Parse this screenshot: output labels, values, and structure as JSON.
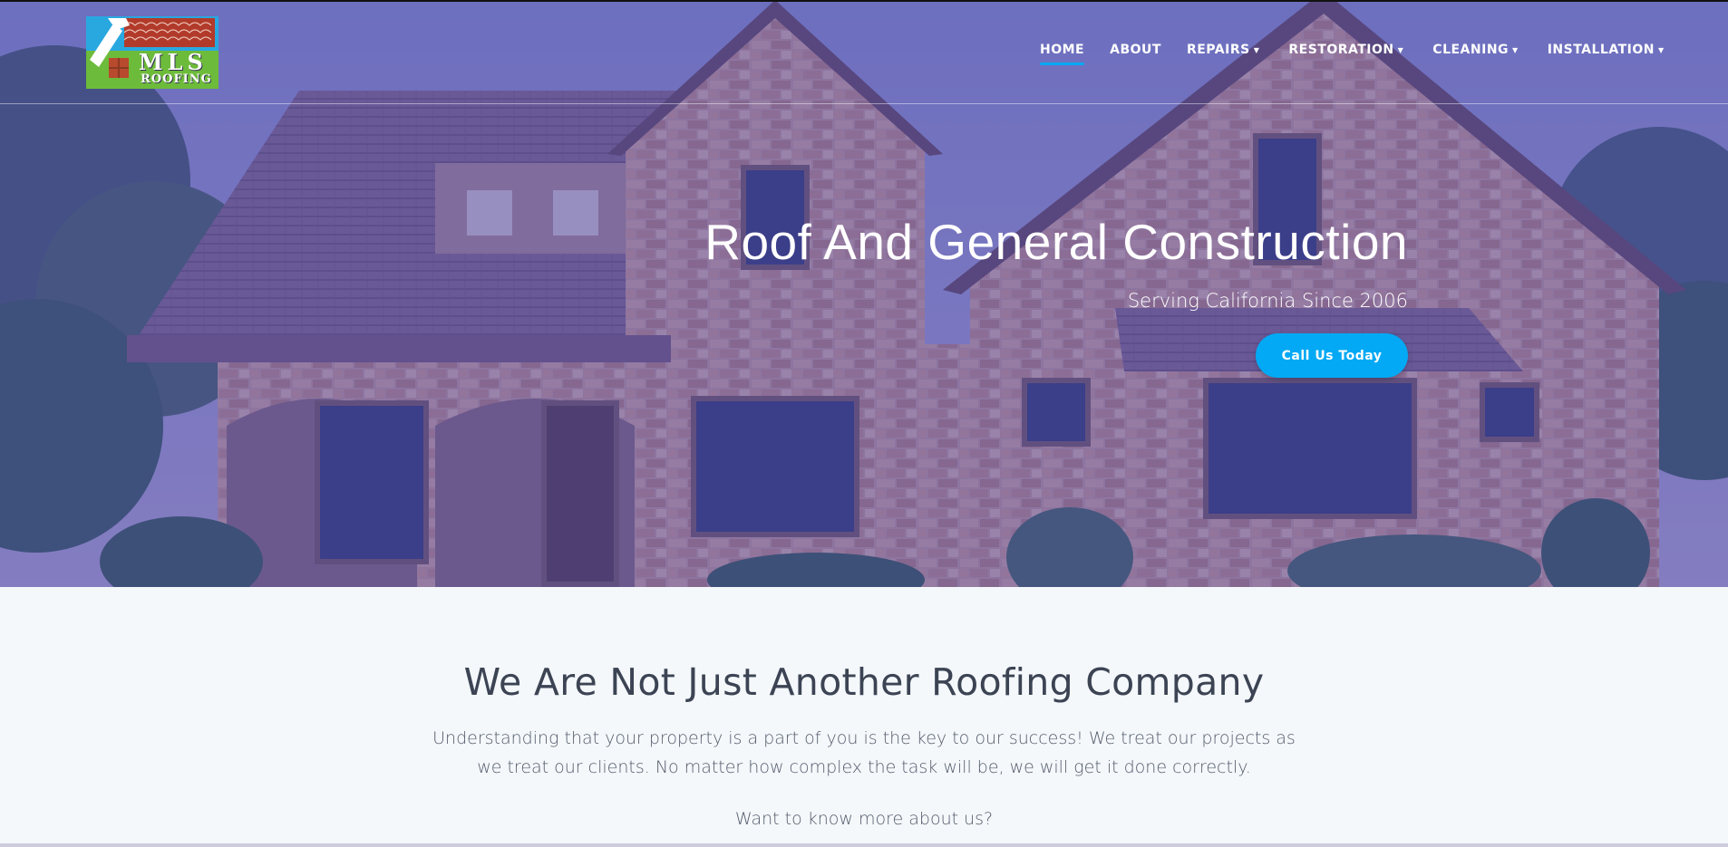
{
  "brand": {
    "logo_text_main": "MLS",
    "logo_text_sub": "ROOFING"
  },
  "nav": {
    "items": [
      {
        "label": "HOME",
        "active": true,
        "dropdown": false
      },
      {
        "label": "ABOUT",
        "active": false,
        "dropdown": false
      },
      {
        "label": "REPAIRS",
        "active": false,
        "dropdown": true
      },
      {
        "label": "RESTORATION",
        "active": false,
        "dropdown": true
      },
      {
        "label": "CLEANING",
        "active": false,
        "dropdown": true
      },
      {
        "label": "INSTALLATION",
        "active": false,
        "dropdown": true
      }
    ]
  },
  "hero": {
    "title": "Roof And General Construction",
    "subtitle": "Serving California Since 2006",
    "cta_label": "Call Us Today"
  },
  "intro": {
    "heading": "We Are Not Just Another Roofing Company",
    "paragraph": "Understanding that your property is a part of you is the key to our success! We treat our projects as we treat our clients. No matter how complex the task will be, we will get it done correctly.",
    "more_text": "Want to know more about us?"
  },
  "colors": {
    "accent": "#03a9f4",
    "hero_overlay": "#3e42be",
    "logo_green": "#6dbb3a",
    "logo_blue": "#29a8e0",
    "heading_text": "#3c4454",
    "page_bg": "#f4f8fb"
  },
  "icons": {
    "nav_dropdown": "caret-down-icon",
    "logo": "hammer-house-icon"
  }
}
